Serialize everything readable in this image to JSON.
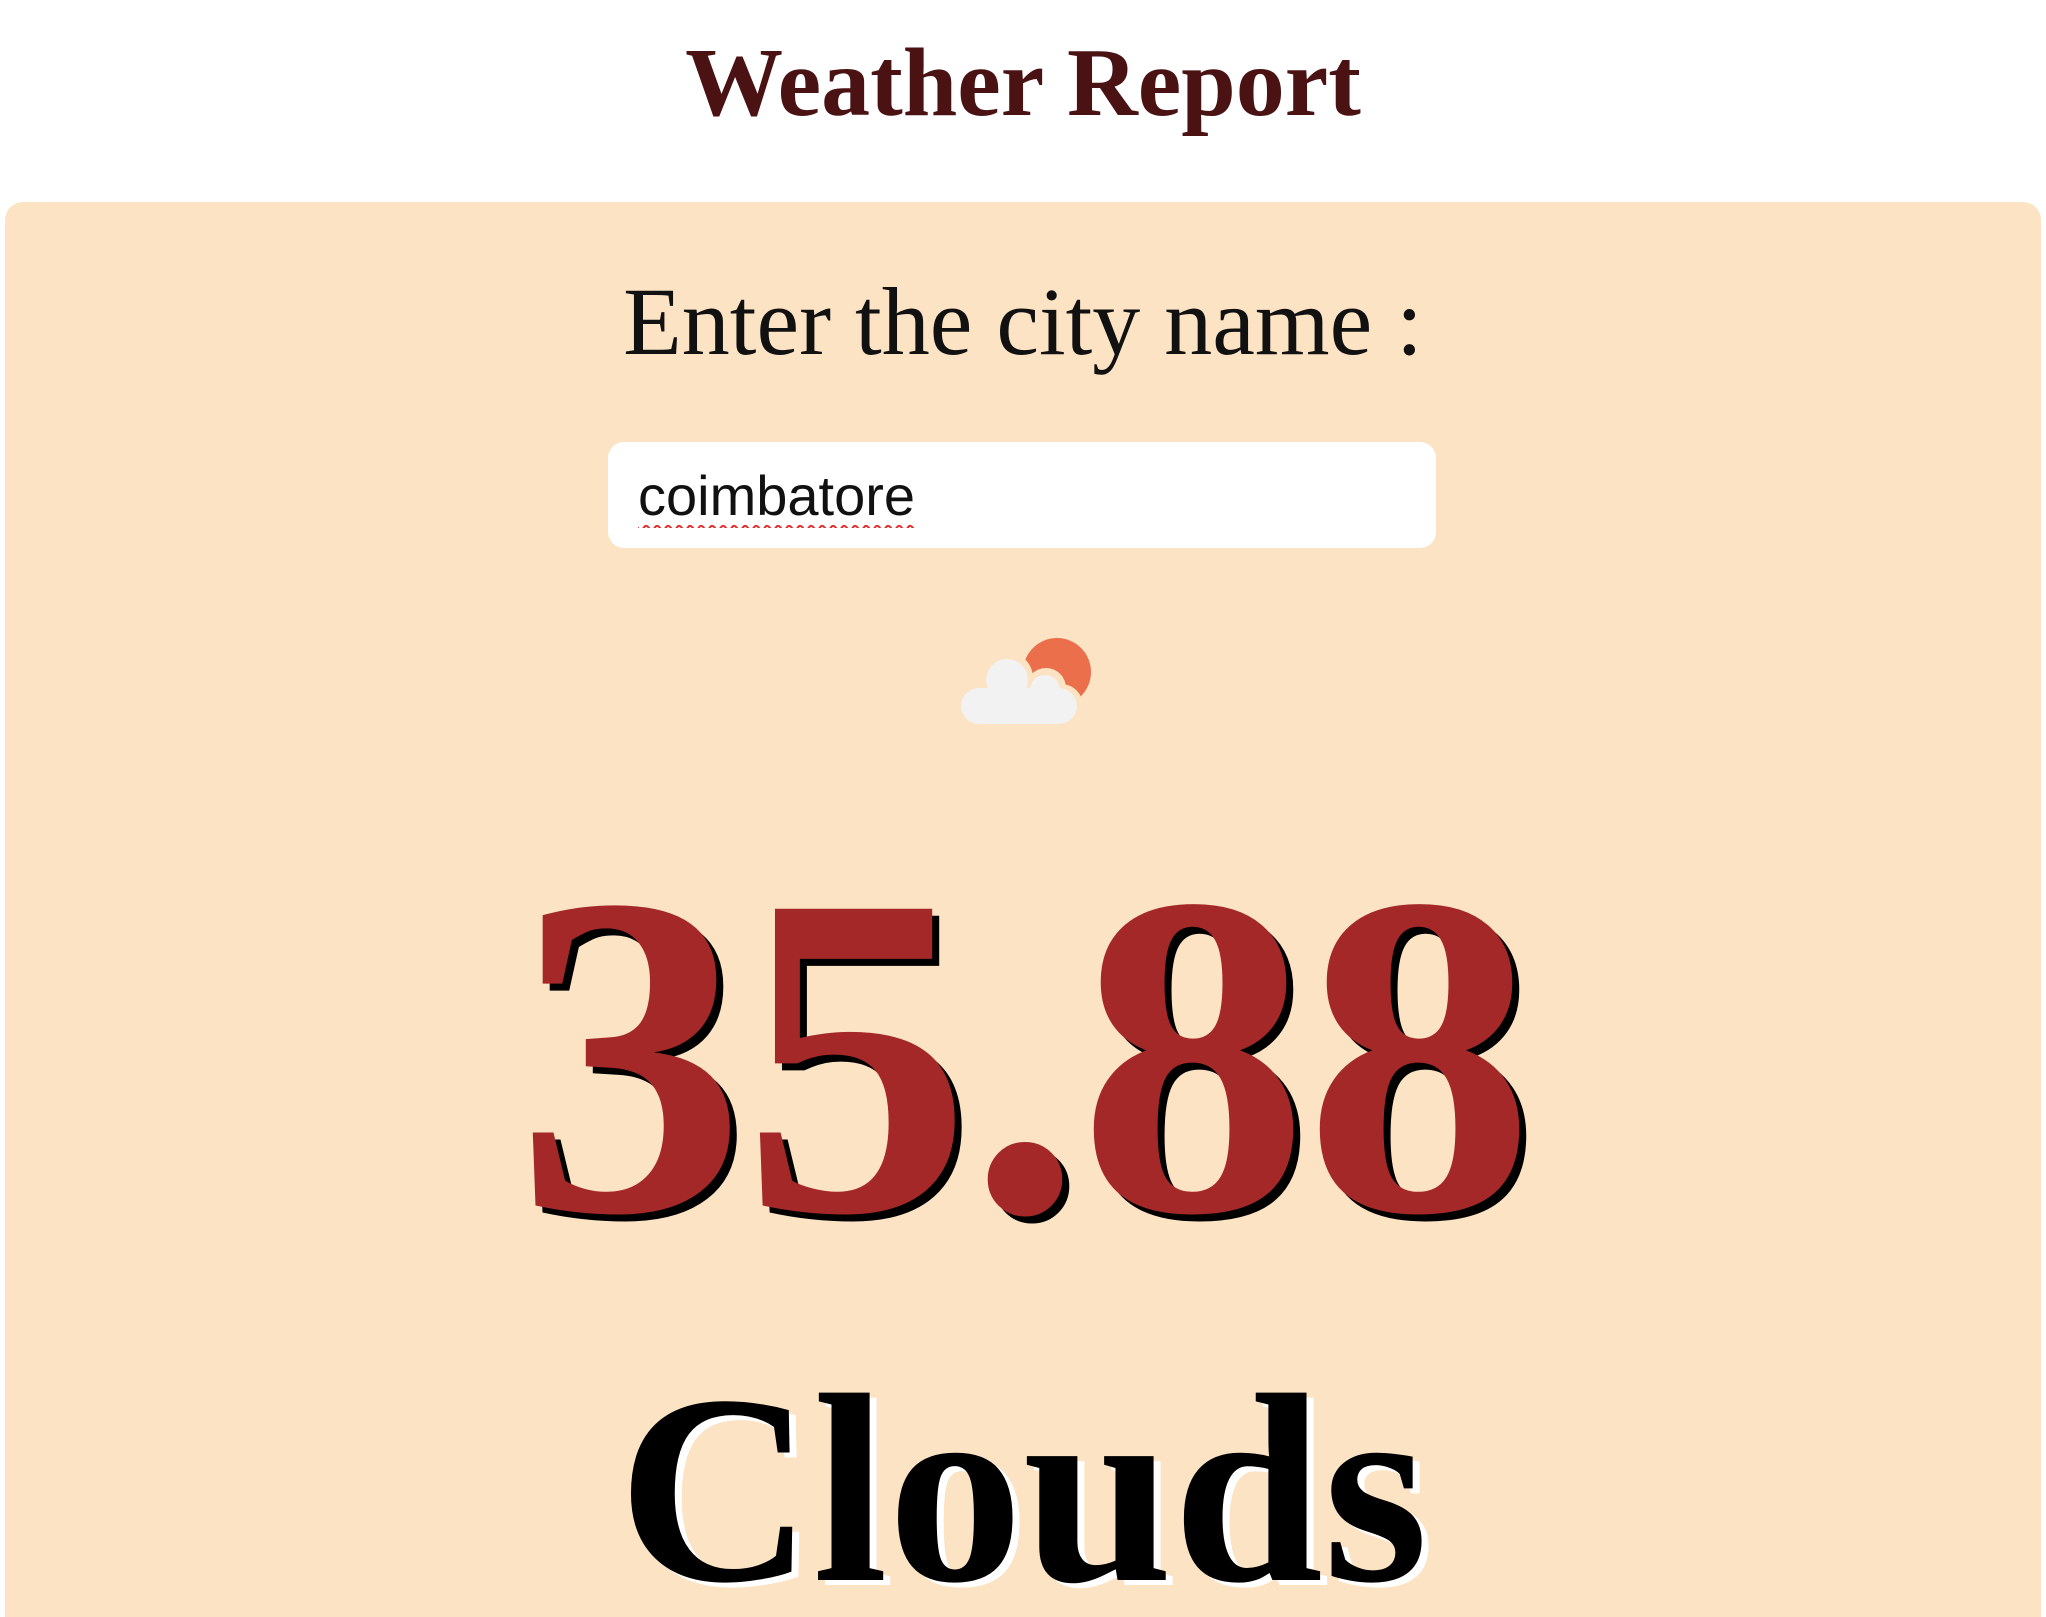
{
  "header": {
    "title": "Weather Report"
  },
  "search": {
    "label": "Enter the city name :",
    "value": "coimbatore"
  },
  "weather": {
    "icon": "partly-cloudy-icon",
    "temperature": "35.88",
    "condition": "Clouds"
  },
  "colors": {
    "title": "#4a1212",
    "panel": "#fce3c4",
    "temperature": "#a52828",
    "sun": "#ec6f4b",
    "cloud": "#f2f2f2"
  }
}
